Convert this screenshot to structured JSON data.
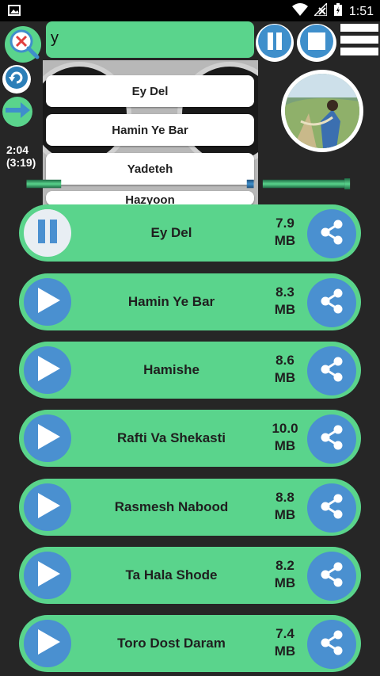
{
  "status_bar": {
    "time": "1:51",
    "icons": [
      "image-icon",
      "wifi-icon",
      "signal-icon",
      "battery-icon"
    ]
  },
  "player": {
    "elapsed": "2:04",
    "duration": "(3:19)",
    "search_value": "y",
    "suggestions": [
      "Ey Del",
      "Hamin Ye Bar",
      "Yadeteh",
      "Hazyoon"
    ],
    "icons": {
      "clear_search": "search-clear-icon",
      "repeat": "repeat-icon",
      "next": "arrow-right-icon",
      "pause": "pause-icon",
      "stop": "stop-icon",
      "menu": "menu-icon"
    }
  },
  "songs": [
    {
      "title": "Ey Del",
      "size_value": "7.9",
      "size_unit": "MB",
      "state": "playing"
    },
    {
      "title": "Hamin Ye Bar",
      "size_value": "8.3",
      "size_unit": "MB",
      "state": "stopped"
    },
    {
      "title": "Hamishe",
      "size_value": "8.6",
      "size_unit": "MB",
      "state": "stopped"
    },
    {
      "title": "Rafti Va Shekasti",
      "size_value": "10.0",
      "size_unit": "MB",
      "state": "stopped"
    },
    {
      "title": "Rasmesh Nabood",
      "size_value": "8.8",
      "size_unit": "MB",
      "state": "stopped"
    },
    {
      "title": "Ta Hala Shode",
      "size_value": "8.2",
      "size_unit": "MB",
      "state": "stopped"
    },
    {
      "title": "Toro Dost Daram",
      "size_value": "7.4",
      "size_unit": "MB",
      "state": "stopped"
    }
  ],
  "colors": {
    "background": "#262626",
    "accent_green": "#5ad48c",
    "accent_blue": "#4a90d0"
  }
}
